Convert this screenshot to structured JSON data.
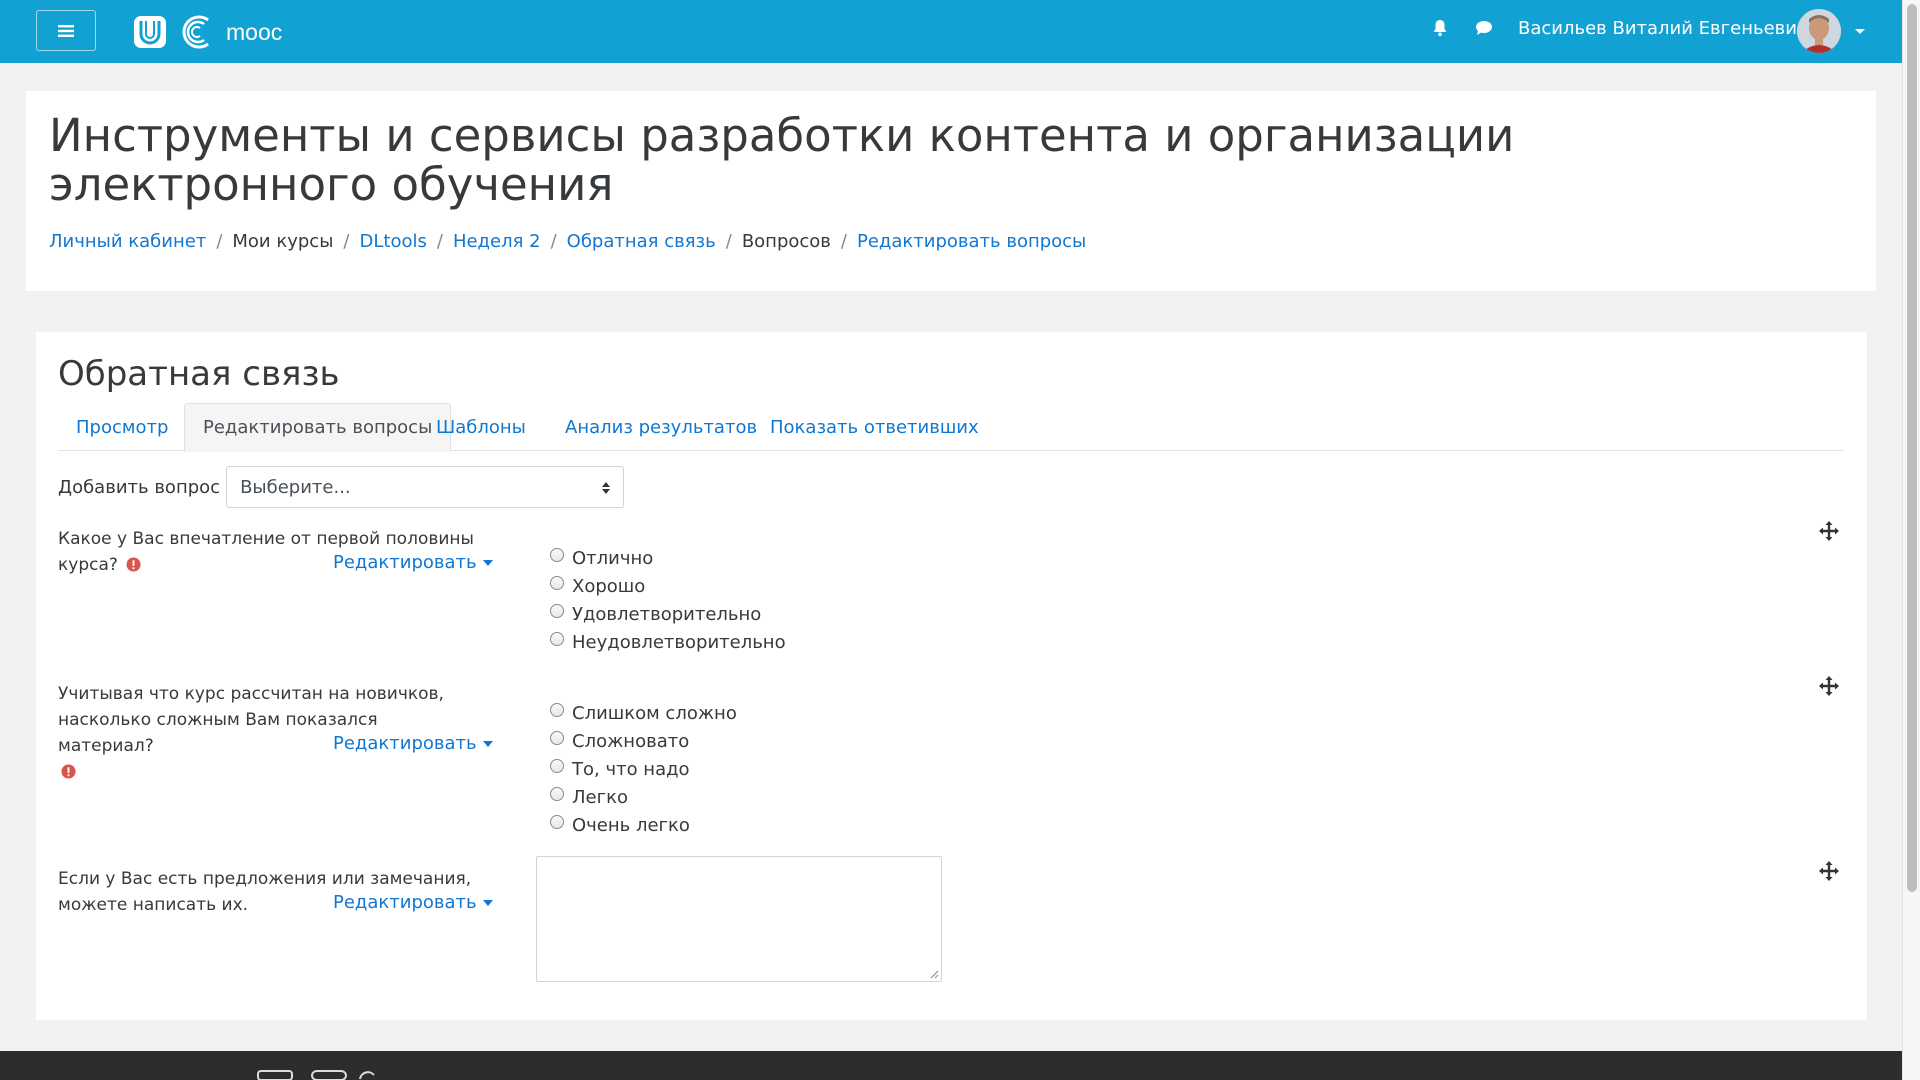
{
  "navbar": {
    "brand_text": "mooc",
    "user_name": "Васильев Виталий Евгеньевич",
    "bg_color": "#12a1d3",
    "icons": [
      "menu-icon",
      "bell-icon",
      "chat-icon",
      "caret-down-icon"
    ]
  },
  "header": {
    "title": "Инструменты и сервисы разработки контента и организации электронного обучения",
    "breadcrumb": [
      {
        "label": "Личный кабинет",
        "link": true
      },
      {
        "label": "Мои курсы",
        "link": false
      },
      {
        "label": "DLtools",
        "link": true
      },
      {
        "label": "Неделя 2",
        "link": true
      },
      {
        "label": "Обратная связь",
        "link": true
      },
      {
        "label": "Вопросов",
        "link": false
      },
      {
        "label": "Редактировать вопросы",
        "link": true
      }
    ]
  },
  "main": {
    "section_title": "Обратная связь",
    "tabs": [
      {
        "label": "Просмотр",
        "active": false
      },
      {
        "label": "Редактировать вопросы",
        "active": true
      },
      {
        "label": "Шаблоны",
        "active": false
      },
      {
        "label": "Анализ результатов",
        "active": false
      },
      {
        "label": "Показать ответивших",
        "active": false
      }
    ],
    "add_question_label": "Добавить вопрос",
    "add_question_select": "Выберите...",
    "edit_label": "Редактировать",
    "questions": [
      {
        "label_line1": "Какое у Вас впечатление от первой половины",
        "label_line2": "курса?",
        "required": true,
        "options": [
          "Отлично",
          "Хорошо",
          "Удовлетворительно",
          "Неудовлетворительно"
        ]
      },
      {
        "label_line1": "Учитывая что курс рассчитан на новичков,",
        "label_line2": "насколько сложным Вам показался материал?",
        "required": true,
        "options": [
          "Слишком сложно",
          "Сложновато",
          "То, что надо",
          "Легко",
          "Очень легко"
        ]
      },
      {
        "label_line1": "Если у Вас есть предложения или замечания,",
        "label_line2": "можете написать их.",
        "required": false,
        "textarea_value": ""
      }
    ]
  },
  "colors": {
    "link": "#1177d1",
    "required_icon": "#d9534f",
    "footer": "#2d2d2d"
  }
}
